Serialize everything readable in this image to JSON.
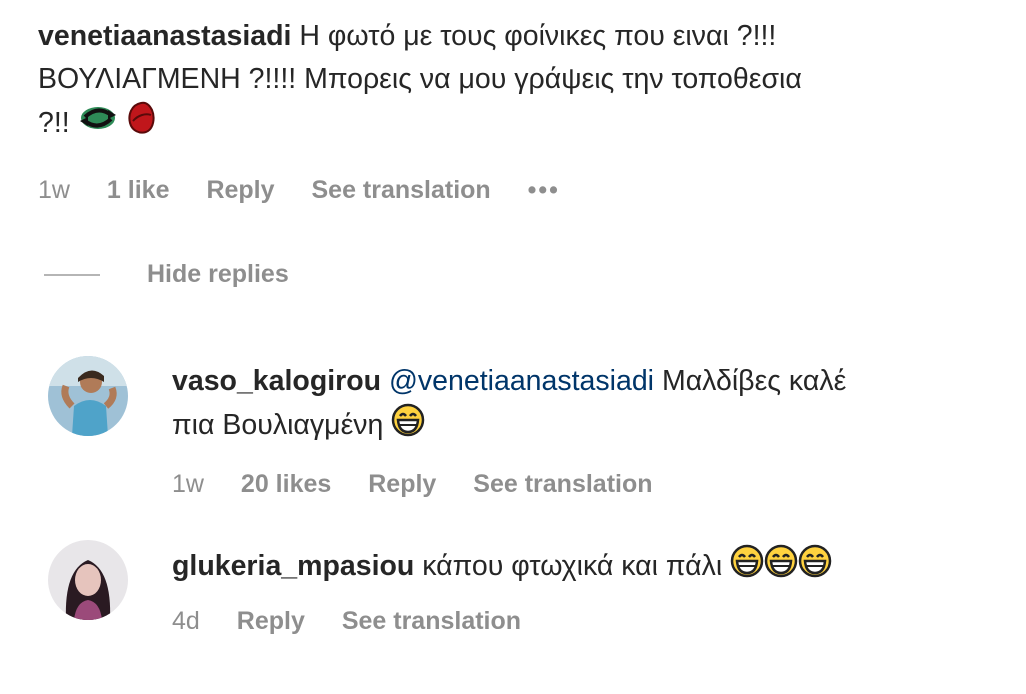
{
  "comment": {
    "username": "venetiaanastasiadi",
    "text_line1": "Η φωτό με τους φοίνικες που ειναι ?!!!",
    "text_line2": "ΒΟΥΛΙΑΓΜΕΝΗ ?!!!! Μπορεις να μου γράψεις την τοποθεσια",
    "text_line3": "?!!",
    "time": "1w",
    "likes": "1 like",
    "reply": "Reply",
    "translate": "See translation",
    "more": "•••"
  },
  "hide_replies": "Hide replies",
  "replies": [
    {
      "username": "vaso_kalogirou",
      "mention": "@venetiaanastasiadi",
      "text_line1": "Μαλδίβες καλέ",
      "text_line2": "πια Βουλιαγμένη",
      "time": "1w",
      "likes": "20 likes",
      "reply": "Reply",
      "translate": "See translation"
    },
    {
      "username": "glukeria_mpasiou",
      "text_line1": "κάπου φτωχικά και πάλι",
      "time": "4d",
      "reply": "Reply",
      "translate": "See translation"
    }
  ],
  "icons": {
    "first_comment": [
      "arrows-cycle-emoji",
      "kiss-lips-emoji"
    ],
    "reply_1": [
      "laughing-face-emoji"
    ],
    "reply_2": [
      "laughing-face-emoji",
      "laughing-face-emoji",
      "laughing-face-emoji"
    ]
  },
  "colors": {
    "text": "#262626",
    "meta": "#8e8e8e",
    "mention": "#003569"
  }
}
